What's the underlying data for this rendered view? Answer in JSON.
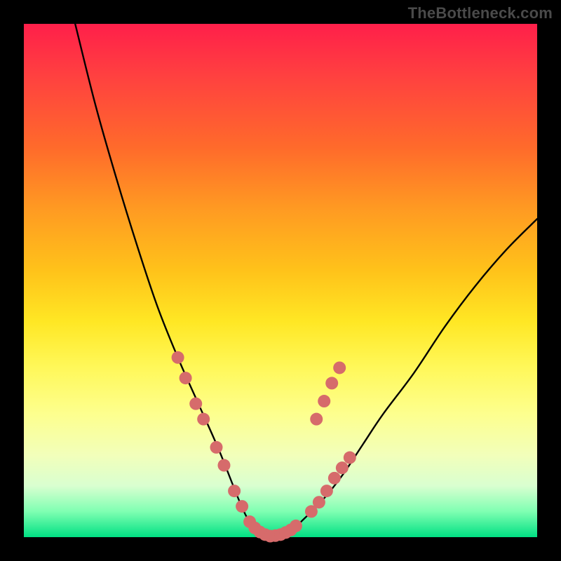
{
  "watermark": "TheBottleneck.com",
  "colors": {
    "background": "#000000",
    "curve": "#000000",
    "dot_fill": "#d66b6b",
    "dot_stroke": "#bb5a5a"
  },
  "chart_data": {
    "type": "line",
    "title": "",
    "xlabel": "",
    "ylabel": "",
    "xlim": [
      0,
      100
    ],
    "ylim": [
      0,
      100
    ],
    "grid": false,
    "legend": false,
    "annotations": [
      "TheBottleneck.com"
    ],
    "note": "Axes have no tick labels; x and y are normalized 0–100 from the visible plot area (0,0 = bottom-left). Curve is a V-shaped valley (bottleneck plot) touching ~0 near x≈44–52, rising steeply to ~100 at x≈10 (left edge of curve) and ~62 at x≈100 (right edge).",
    "series": [
      {
        "name": "bottleneck-curve",
        "x": [
          10,
          14,
          18,
          22,
          26,
          30,
          34,
          38,
          42,
          44,
          46,
          48,
          50,
          52,
          54,
          58,
          62,
          66,
          70,
          76,
          82,
          88,
          94,
          100
        ],
        "y": [
          100,
          84,
          70,
          57,
          45,
          35,
          26,
          17,
          7,
          3,
          1,
          0,
          0,
          1,
          3,
          7,
          12,
          18,
          24,
          32,
          41,
          49,
          56,
          62
        ]
      }
    ],
    "dots": {
      "name": "sample-points",
      "note": "Salmon dots lying on the curve, clustered on the steep flanks and along the flat bottom.",
      "points": [
        {
          "x": 30.0,
          "y": 35.0
        },
        {
          "x": 31.5,
          "y": 31.0
        },
        {
          "x": 33.5,
          "y": 26.0
        },
        {
          "x": 35.0,
          "y": 23.0
        },
        {
          "x": 37.5,
          "y": 17.5
        },
        {
          "x": 39.0,
          "y": 14.0
        },
        {
          "x": 41.0,
          "y": 9.0
        },
        {
          "x": 42.5,
          "y": 6.0
        },
        {
          "x": 44.0,
          "y": 3.0
        },
        {
          "x": 45.0,
          "y": 1.8
        },
        {
          "x": 46.0,
          "y": 1.0
        },
        {
          "x": 47.0,
          "y": 0.5
        },
        {
          "x": 48.0,
          "y": 0.2
        },
        {
          "x": 49.0,
          "y": 0.3
        },
        {
          "x": 50.0,
          "y": 0.5
        },
        {
          "x": 51.0,
          "y": 0.9
        },
        {
          "x": 52.0,
          "y": 1.4
        },
        {
          "x": 53.0,
          "y": 2.2
        },
        {
          "x": 56.0,
          "y": 5.0
        },
        {
          "x": 57.5,
          "y": 6.8
        },
        {
          "x": 59.0,
          "y": 9.0
        },
        {
          "x": 60.5,
          "y": 11.5
        },
        {
          "x": 62.0,
          "y": 13.5
        },
        {
          "x": 63.5,
          "y": 15.5
        },
        {
          "x": 57.0,
          "y": 23.0
        },
        {
          "x": 58.5,
          "y": 26.5
        },
        {
          "x": 60.0,
          "y": 30.0
        },
        {
          "x": 61.5,
          "y": 33.0
        }
      ]
    }
  }
}
